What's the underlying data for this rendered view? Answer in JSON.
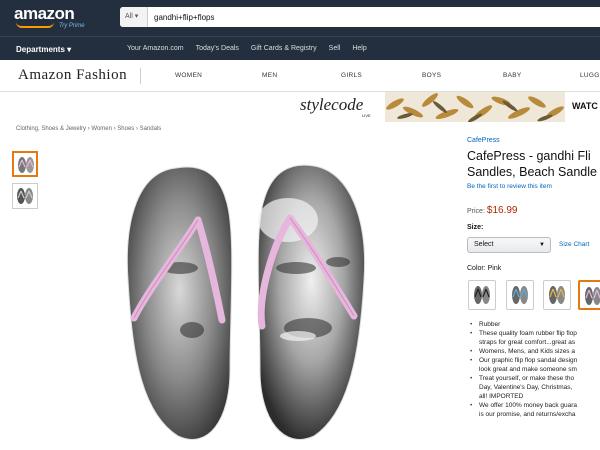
{
  "header": {
    "logo": "amazon",
    "logo_sub": "Try Prime",
    "search_category": "All",
    "search_value": "gandhi+flip+flops"
  },
  "subnav": {
    "departments": "Departments",
    "links": [
      "Your Amazon.com",
      "Today's Deals",
      "Gift Cards & Registry",
      "Sell",
      "Help"
    ]
  },
  "fashion": {
    "logo": "Amazon Fashion",
    "nav": [
      "WOMEN",
      "MEN",
      "GIRLS",
      "BOYS",
      "BABY",
      "LUGG"
    ]
  },
  "banner": {
    "logo": "stylecode",
    "sublabel": "LIVE",
    "cta": "WATC"
  },
  "breadcrumb": "Clothing, Shoes & Jewelry › Women › Shoes › Sandals",
  "product": {
    "brand": "CafePress",
    "title_line1": "CafePress - gandhi Fli",
    "title_line2": "Sandles, Beach Sandle",
    "review_link": "Be the first to review this item",
    "price_label": "Price:",
    "price": "$16.99",
    "size_label": "Size:",
    "size_select": "Select",
    "size_chart": "Size Chart",
    "color_label": "Color:",
    "color_value": "Pink",
    "bullets": [
      "Rubber",
      "These quality foam rubber flip flop",
      "straps for great comfort...great as",
      "Womens, Mens, and Kids sizes a",
      "Our graphic flip flop sandal design",
      "look great and make someone sm",
      "Treat yourself, or make these tho",
      "Day, Valentine's Day, Christmas,",
      "all! IMPORTED",
      "We offer 100% money back guara",
      "is our promise, and returns/excha"
    ]
  },
  "colors": {
    "nav_bg": "#232f3e",
    "accent": "#e47911",
    "link": "#0066c0",
    "price": "#b12704",
    "strap": "#e7b6dc"
  }
}
